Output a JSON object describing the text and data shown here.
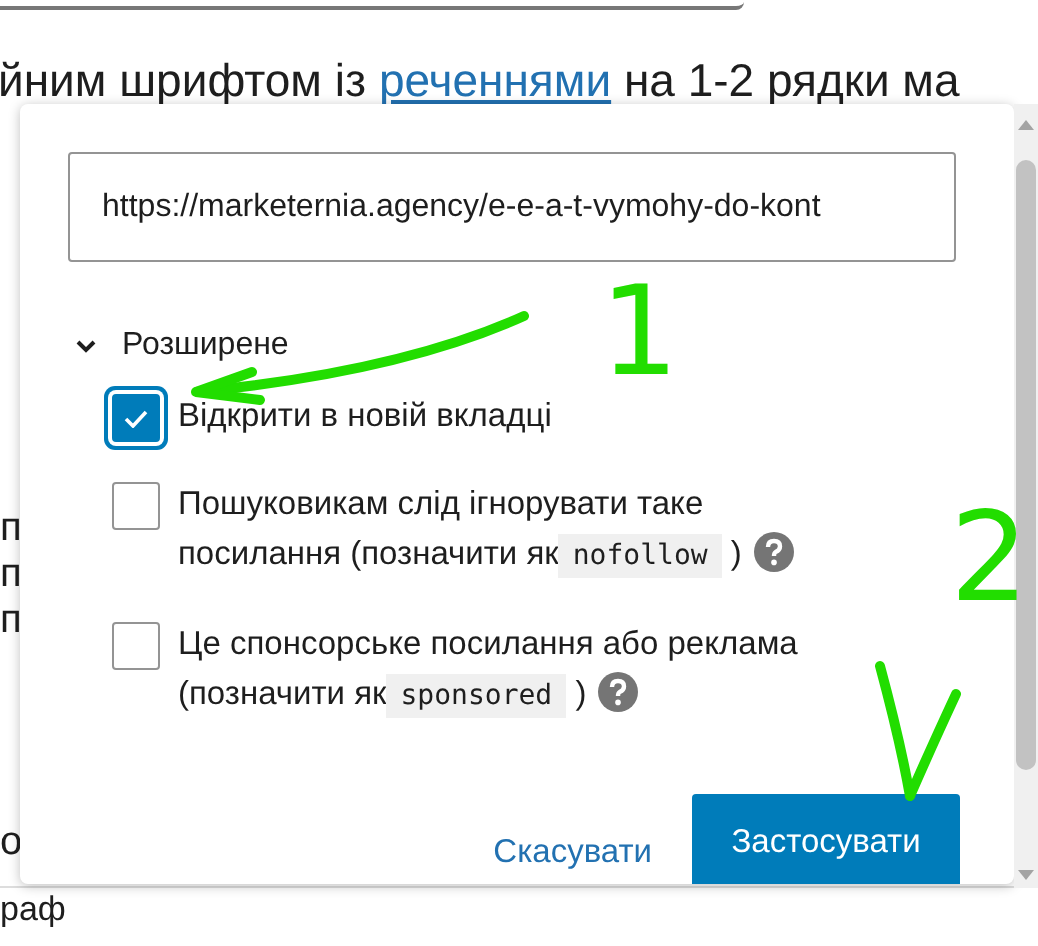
{
  "paragraph": {
    "before": "йним шрифтом із ",
    "link": "реченнями",
    "after": " на 1-2 рядки ма"
  },
  "line_fragments": [
    "п",
    "п",
    "п"
  ],
  "lower_fragment": "о",
  "below_text": "раф",
  "link_popover": {
    "url": "https://marketernia.agency/e-e-a-t-vymohy-do-kont",
    "advanced": {
      "label": "Розширене",
      "expanded": true
    },
    "options": [
      {
        "text": "Відкрити в новій вкладці",
        "checked": true
      },
      {
        "text": "Пошуковикам слід ігнорувати таке посилання (позначити як",
        "code": "nofollow",
        "after": ")",
        "help": true,
        "checked": false
      },
      {
        "text": "Це спонсорське посилання або реклама (позначити як",
        "code": "sponsored",
        "after": ")",
        "help": true,
        "checked": false
      }
    ],
    "buttons": [
      {
        "kind": "link",
        "label": "Скасувати"
      },
      {
        "kind": "primary",
        "label": "Застосувати"
      }
    ]
  },
  "annotations": [
    {
      "label": "1"
    },
    {
      "label": "2"
    }
  ]
}
